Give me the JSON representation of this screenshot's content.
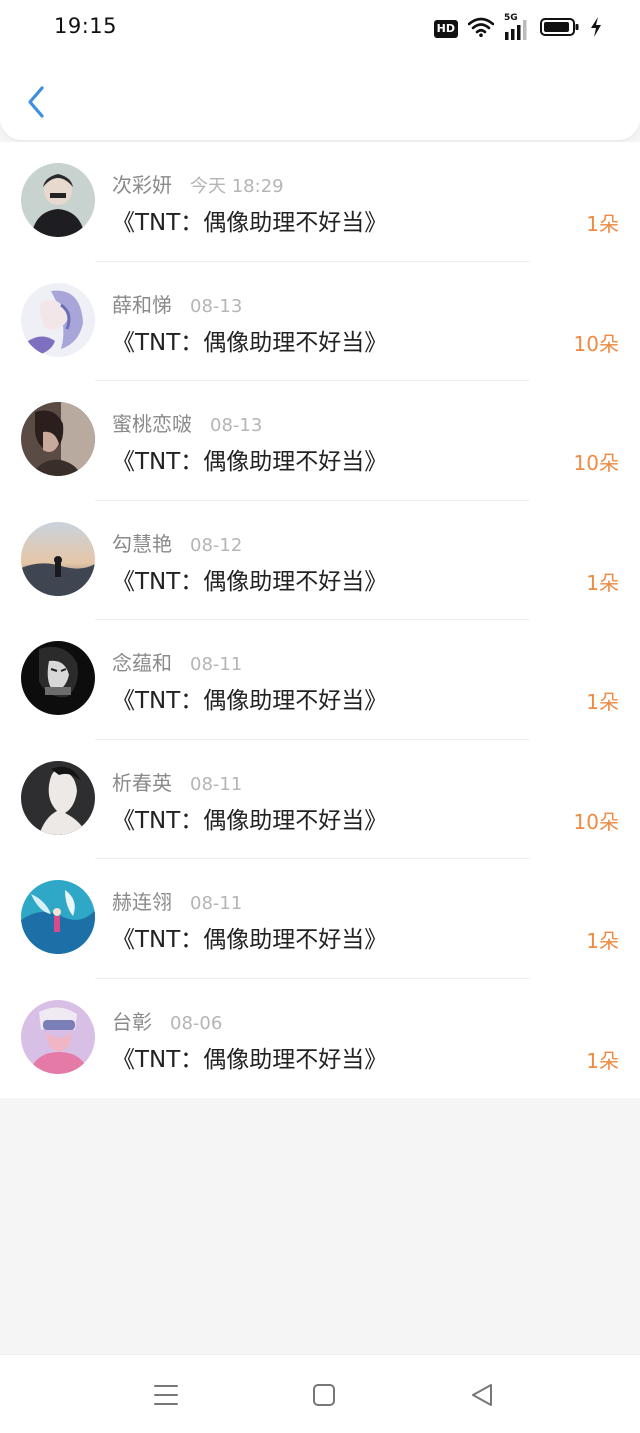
{
  "status_bar": {
    "time": "19:15",
    "hd_label": "HD",
    "network_label": "5G",
    "icons": [
      "hd-icon",
      "wifi-icon",
      "signal-5g-icon",
      "battery-icon",
      "charging-icon"
    ]
  },
  "header": {
    "back_icon": "chevron-left-icon"
  },
  "colors": {
    "accent_blue": "#3d8fe0",
    "amount_orange": "#ef8a43",
    "name_gray": "#8a8a8a",
    "date_gray": "#b5b5b5",
    "title_dark": "#222222"
  },
  "gifts": [
    {
      "name": "次彩妍",
      "date": "今天 18:29",
      "title": "《TNT：偶像助理不好当》",
      "amount": "1朵"
    },
    {
      "name": "薛和悌",
      "date": "08-13",
      "title": "《TNT：偶像助理不好当》",
      "amount": "10朵"
    },
    {
      "name": "蜜桃恋啵",
      "date": "08-13",
      "title": "《TNT：偶像助理不好当》",
      "amount": "10朵"
    },
    {
      "name": "勾慧艳",
      "date": "08-12",
      "title": "《TNT：偶像助理不好当》",
      "amount": "1朵"
    },
    {
      "name": "念蕴和",
      "date": "08-11",
      "title": "《TNT：偶像助理不好当》",
      "amount": "1朵"
    },
    {
      "name": "析春英",
      "date": "08-11",
      "title": "《TNT：偶像助理不好当》",
      "amount": "10朵"
    },
    {
      "name": "赫连翎",
      "date": "08-11",
      "title": "《TNT：偶像助理不好当》",
      "amount": "1朵"
    },
    {
      "name": "台彰",
      "date": "08-06",
      "title": "《TNT：偶像助理不好当》",
      "amount": "1朵"
    }
  ],
  "nav_bar": {
    "icons": [
      "menu-icon",
      "home-square-icon",
      "back-triangle-icon"
    ]
  }
}
